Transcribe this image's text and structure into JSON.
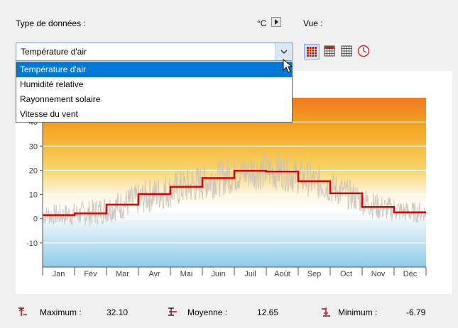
{
  "header": {
    "data_type_label": "Type de données :",
    "unit_label": "°C",
    "view_label": "Vue :"
  },
  "combo": {
    "selected": "Température d'air",
    "options": [
      "Température d'air",
      "Humidité relative",
      "Rayonnement solaire",
      "Vitesse du vent"
    ]
  },
  "view_icons": [
    "heatmap-red-icon",
    "table-grid-icon",
    "table-grid-icon",
    "clock-icon"
  ],
  "chart_data": {
    "type": "line",
    "x_categories": [
      "Jan",
      "Fév",
      "Mar",
      "Avr",
      "Mai",
      "Juin",
      "Juil",
      "Août",
      "Sep",
      "Oct",
      "Nov",
      "Déc"
    ],
    "monthly_mean": [
      1.5,
      2.2,
      5.8,
      10.2,
      13.2,
      16.8,
      19.8,
      19.5,
      15.5,
      10.5,
      4.8,
      2.6
    ],
    "y_ticks": [
      40,
      30,
      20,
      10,
      0,
      -10
    ],
    "ylim": [
      -20,
      50
    ],
    "series_color": "#e00000",
    "raw_color": "#c9c2b6"
  },
  "stats": {
    "max_label": "Maximum :",
    "max_value": "32.10",
    "mean_label": "Moyenne :",
    "mean_value": "12.65",
    "min_label": "Minimum :",
    "min_value": "-6.79"
  }
}
